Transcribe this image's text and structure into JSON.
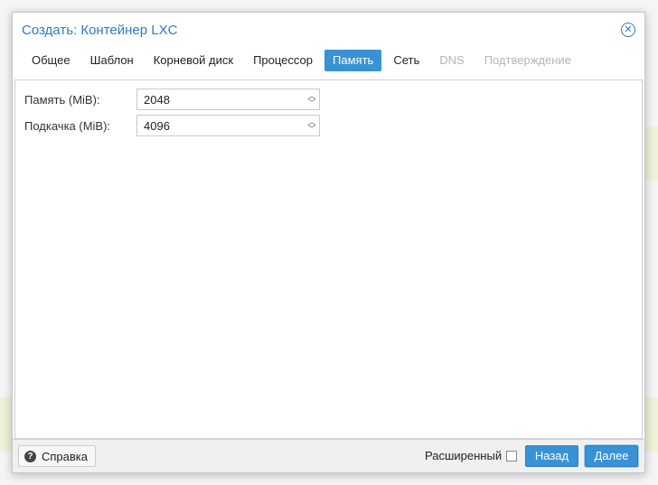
{
  "dialog": {
    "title": "Создать: Контейнер LXC",
    "close_icon": "close-circle-icon"
  },
  "tabs": [
    {
      "label": "Общее",
      "state": "normal"
    },
    {
      "label": "Шаблон",
      "state": "normal"
    },
    {
      "label": "Корневой диск",
      "state": "normal"
    },
    {
      "label": "Процессор",
      "state": "normal"
    },
    {
      "label": "Память",
      "state": "active"
    },
    {
      "label": "Сеть",
      "state": "normal"
    },
    {
      "label": "DNS",
      "state": "disabled"
    },
    {
      "label": "Подтверждение",
      "state": "disabled"
    }
  ],
  "form": {
    "memory_label": "Память (MiB):",
    "memory_value": "2048",
    "swap_label": "Подкачка (MiB):",
    "swap_value": "4096"
  },
  "footer": {
    "help_label": "Справка",
    "advanced_label": "Расширенный",
    "advanced_checked": false,
    "back_label": "Назад",
    "next_label": "Далее"
  },
  "colors": {
    "accent": "#3892d4",
    "title": "#2e7bc4"
  }
}
